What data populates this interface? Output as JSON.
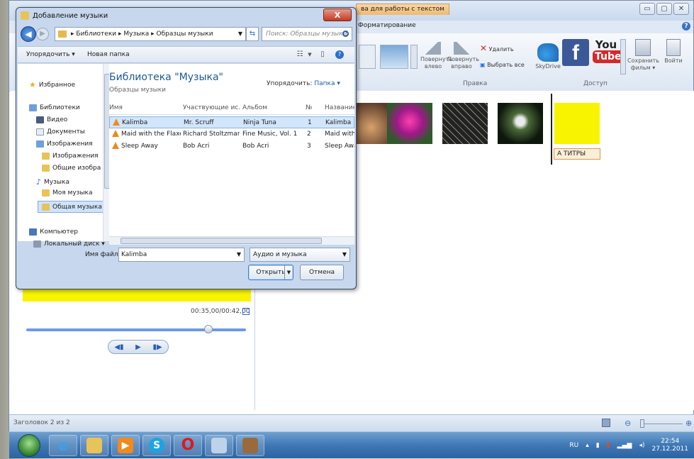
{
  "dialog": {
    "title": "Добавление музыки",
    "close_label": "X",
    "address": "▸ Библиотеки ▸ Музыка ▸ Образцы музыки",
    "search_placeholder": "Поиск: Образцы музыки",
    "toolbar": {
      "organize": "Упорядочить ▾",
      "new_folder": "Новая папка"
    },
    "nav": {
      "favorites": "Избранное",
      "libraries": "Библиотеки",
      "video": "Видео",
      "documents": "Документы",
      "images": "Изображения",
      "images_sub": "Изображения",
      "public_images": "Общие изобра",
      "music": "Музыка",
      "my_music": "Моя музыка",
      "public_music": "Общая музыка",
      "computer": "Компьютер",
      "local_disk": "Локальный диск ▾"
    },
    "library_title": "Библиотека \"Музыка\"",
    "library_subtitle": "Образцы музыки",
    "arrange_label": "Упорядочить:",
    "arrange_value": "Папка ▾",
    "columns": [
      "Имя",
      "Участвующие ис...",
      "Альбом",
      "№",
      "Название"
    ],
    "rows": [
      {
        "name": "Kalimba",
        "artist": "Mr. Scruff",
        "album": "Ninja Tuna",
        "num": "1",
        "title": "Kalimba"
      },
      {
        "name": "Maid with the Flaxe...",
        "artist": "Richard Stoltzman...",
        "album": "Fine Music, Vol. 1",
        "num": "2",
        "title": "Maid with"
      },
      {
        "name": "Sleep Away",
        "artist": "Bob Acri",
        "album": "Bob Acri",
        "num": "3",
        "title": "Sleep Awa"
      }
    ],
    "filename_label": "Имя файла:",
    "filename_value": "Kalimba",
    "filetype_value": "Аудио и музыка",
    "open_label": "Открыть",
    "cancel_label": "Отмена"
  },
  "moviemaker": {
    "context_tab": "ва для работы с текстом",
    "format_tab": "Форматирование",
    "ribbon": {
      "rotate_left": "Повернуть влево",
      "rotate_right": "Повернуть вправо",
      "delete": "Удалить",
      "select_all": "Выбрать все",
      "edit_group": "Правка",
      "skydrive": "SkyDrive",
      "facebook": "f",
      "youtube_you": "You",
      "youtube_tube": "Tube",
      "save_movie": "Сохранить фильм ▾",
      "sign_in": "Войти",
      "share_group": "Доступ"
    },
    "title_clip": "А ТИТРЫ",
    "timecode": "00:35,00/00:42,00",
    "status": "Заголовок 2 из 2"
  },
  "taskbar": {
    "lang": "RU",
    "time": "22:54",
    "date": "27.12.2011"
  },
  "colors": {
    "title_clip": "#f8f400",
    "accent": "#1d5a96",
    "taskbar": "#3f78b5"
  }
}
